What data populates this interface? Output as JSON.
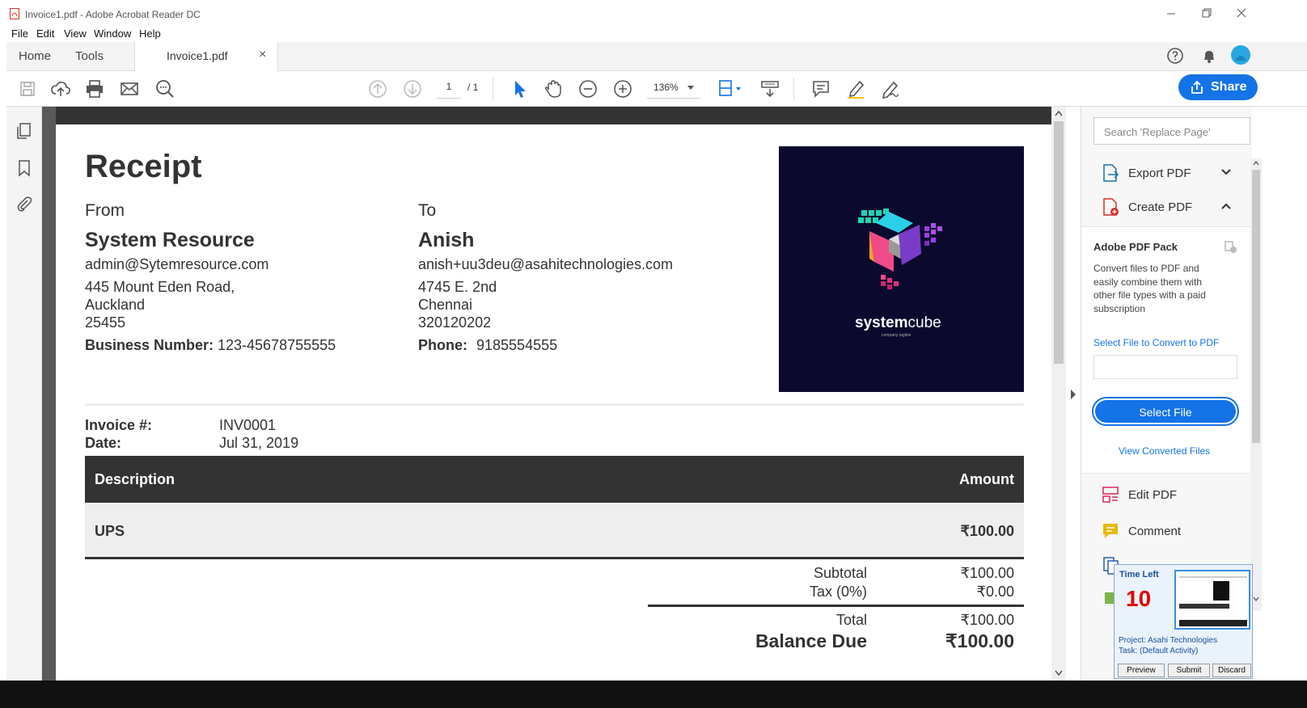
{
  "window": {
    "title": "Invoice1.pdf - Adobe Acrobat Reader DC"
  },
  "menu": {
    "file": "File",
    "edit": "Edit",
    "view": "View",
    "window": "Window",
    "help": "Help"
  },
  "tabs": {
    "home": "Home",
    "tools": "Tools",
    "document": "Invoice1.pdf",
    "close": "×"
  },
  "toolbar": {
    "page_current": "1",
    "page_total": "/ 1",
    "zoom": "136%",
    "share_label": "Share"
  },
  "colors": {
    "accent": "#1473e6",
    "invoice_header_bg": "#333333",
    "logo_bg": "#0b0a2e"
  },
  "receipt": {
    "title": "Receipt",
    "from_label": "From",
    "from_name": "System Resource",
    "from_email": "admin@Sytemresource.com",
    "from_address1": "445 Mount Eden Road,",
    "from_address2": "Auckland",
    "from_address3": "25455",
    "business_label": "Business Number:",
    "business_value": "123-45678755555",
    "to_label": "To",
    "to_name": "Anish",
    "to_email": "anish+uu3deu@asahitechnologies.com",
    "to_address1": "4745 E. 2nd",
    "to_address2": "Chennai",
    "to_address3": "320120202",
    "phone_label": "Phone:",
    "phone_value": "9185554555",
    "logo_text_bold": "system",
    "logo_text_light": "cube",
    "logo_tagline": "company tagline",
    "invoice_label": "Invoice #:",
    "invoice_value": "INV0001",
    "date_label": "Date:",
    "date_value": "Jul 31, 2019",
    "table_header_desc": "Description",
    "table_header_amount": "Amount",
    "item_desc": "UPS",
    "item_amount": "₹100.00",
    "subtotal_label": "Subtotal",
    "subtotal_value": "₹100.00",
    "tax_label": "Tax (0%)",
    "tax_value": "₹0.00",
    "total_label": "Total",
    "total_value": "₹100.00",
    "balance_label": "Balance Due",
    "balance_value": "₹100.00"
  },
  "right_panel": {
    "search_placeholder": "Search 'Replace Page'",
    "export_pdf": "Export PDF",
    "create_pdf": "Create PDF",
    "pack_title": "Adobe PDF Pack",
    "pack_desc1": "Convert files to PDF and",
    "pack_desc2": "easily combine them with",
    "pack_desc3": "other file types with a paid",
    "pack_desc4": "subscription",
    "select_file_link": "Select File to Convert to PDF",
    "select_file_button": "Select File",
    "view_converted": "View Converted Files",
    "edit_pdf": "Edit PDF",
    "comment": "Comment"
  },
  "time_popup": {
    "title": "Time Left",
    "value": "10",
    "project": "Project: Asahi Technologies",
    "task": "Task: (Default Activity)",
    "preview": "Preview",
    "submit": "Submit",
    "discard": "Discard"
  }
}
